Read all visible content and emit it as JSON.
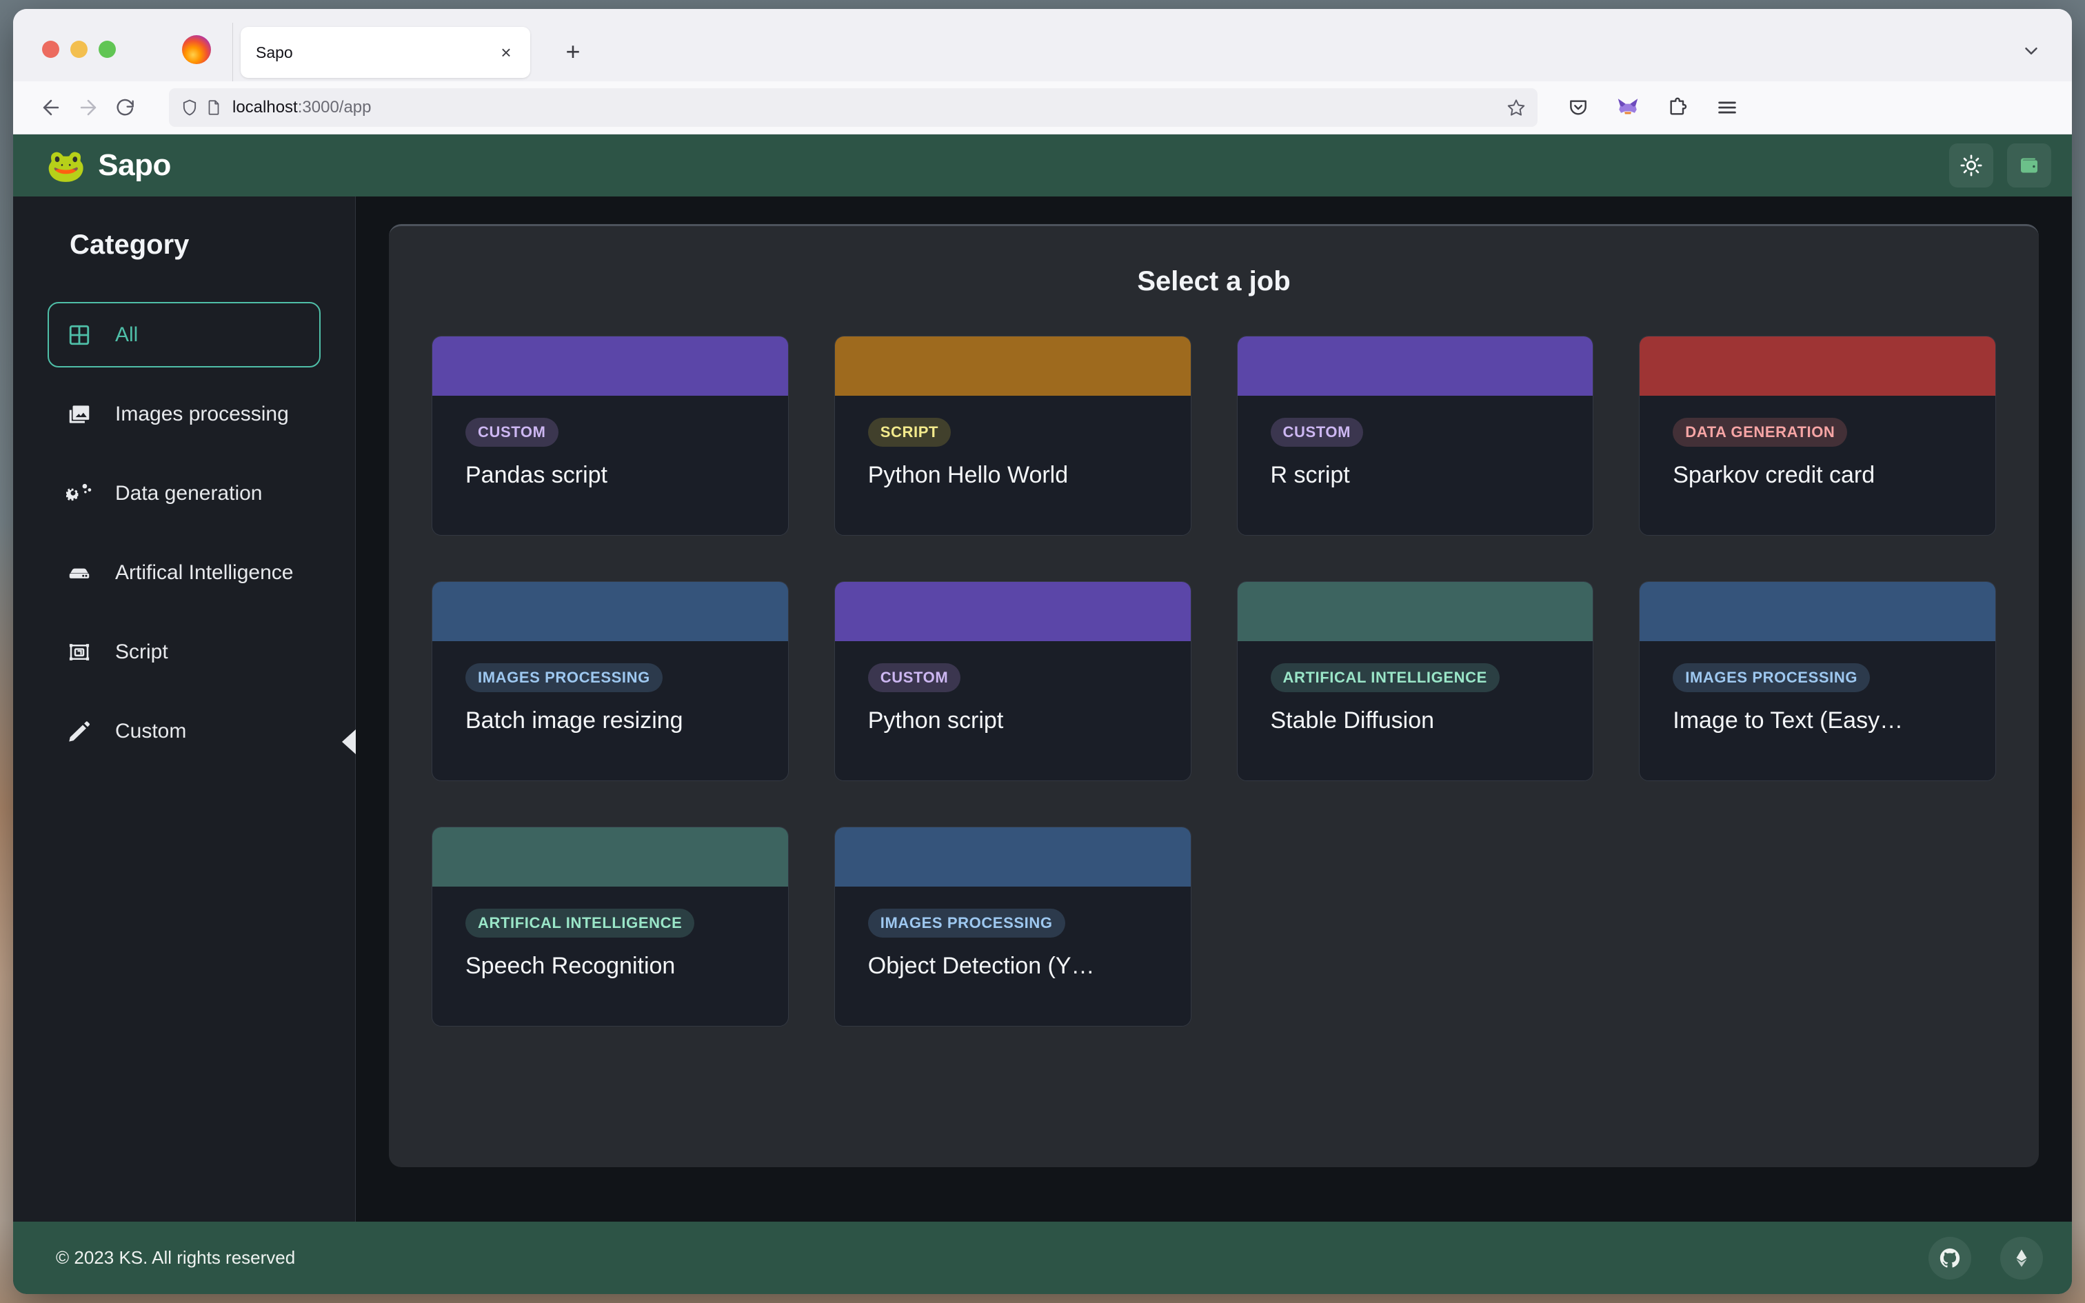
{
  "browser": {
    "tab_title": "Sapo",
    "url_host": "localhost",
    "url_path": ":3000/app",
    "close_glyph": "×",
    "newtab_glyph": "+",
    "tablist_chevron": "⌄",
    "icons": {
      "back": "back-arrow-icon",
      "forward": "forward-arrow-icon",
      "reload": "reload-icon",
      "shield": "shield-icon",
      "page": "page-icon",
      "bookmark": "star-icon",
      "pocket": "pocket-icon",
      "metamask": "metamask-fox-icon",
      "extensions": "extensions-puzzle-icon",
      "menu": "hamburger-menu-icon"
    }
  },
  "app": {
    "logo_emoji": "🐸",
    "name": "Sapo",
    "header_buttons": [
      {
        "name": "theme-toggle-button",
        "icon": "sun-icon"
      },
      {
        "name": "wallet-button",
        "icon": "wallet-icon"
      }
    ]
  },
  "sidebar": {
    "title": "Category",
    "items": [
      {
        "label": "All",
        "icon": "grid-icon",
        "active": true
      },
      {
        "label": "Images processing",
        "icon": "images-icon",
        "active": false
      },
      {
        "label": "Data generation",
        "icon": "gears-icon",
        "active": false
      },
      {
        "label": "Artifical Intelligence",
        "icon": "server-icon",
        "active": false
      },
      {
        "label": "Script",
        "icon": "script-frame-icon",
        "active": false
      },
      {
        "label": "Custom",
        "icon": "pencil-icon",
        "active": false
      }
    ],
    "collapse_icon": "collapse-left-arrow-icon"
  },
  "main": {
    "panel_title": "Select a job",
    "cards": [
      {
        "title": "Pandas script",
        "badge": "CUSTOM",
        "banner": "#5b46a8",
        "badge_bg": "#3b364f",
        "badge_fg": "#cdb7f2"
      },
      {
        "title": "Python Hello World",
        "badge": "SCRIPT",
        "banner": "#9e6a1e",
        "badge_bg": "#41402c",
        "badge_fg": "#f3ea8c"
      },
      {
        "title": "R script",
        "badge": "CUSTOM",
        "banner": "#5b46a8",
        "badge_bg": "#3b364f",
        "badge_fg": "#cdb7f2"
      },
      {
        "title": "Sparkov credit card",
        "badge": "DATA GENERATION",
        "banner": "#9e3434",
        "badge_bg": "#433037",
        "badge_fg": "#f6a5a5"
      },
      {
        "title": "Batch image resizing",
        "badge": "IMAGES PROCESSING",
        "banner": "#35547b",
        "badge_bg": "#2c3a4c",
        "badge_fg": "#9ec8f0"
      },
      {
        "title": "Python script",
        "badge": "CUSTOM",
        "banner": "#5b46a8",
        "badge_bg": "#3b364f",
        "badge_fg": "#cdb7f2"
      },
      {
        "title": "Stable Diffusion",
        "badge": "ARTIFICAL INTELLIGENCE",
        "banner": "#3d6460",
        "badge_bg": "#2b3f43",
        "badge_fg": "#9ae6c8"
      },
      {
        "title": "Image to Text (Easy…",
        "badge": "IMAGES PROCESSING",
        "banner": "#35547b",
        "badge_bg": "#2c3a4c",
        "badge_fg": "#9ec8f0"
      },
      {
        "title": "Speech Recognition",
        "badge": "ARTIFICAL INTELLIGENCE",
        "banner": "#3d6460",
        "badge_bg": "#2b3f43",
        "badge_fg": "#9ae6c8"
      },
      {
        "title": "Object Detection (Y…",
        "badge": "IMAGES PROCESSING",
        "banner": "#35547b",
        "badge_bg": "#2c3a4c",
        "badge_fg": "#9ec8f0"
      }
    ]
  },
  "footer": {
    "copyright": "© 2023 KS. All rights reserved",
    "icons": [
      {
        "name": "github-icon"
      },
      {
        "name": "ethereum-icon"
      }
    ]
  },
  "colors": {
    "brand_green": "#2d5446",
    "accent_teal": "#4fbfa8",
    "panel_bg": "#282b30",
    "card_bg": "#1a1e27",
    "app_bg": "#111418",
    "sidebar_bg": "#1b1e24"
  }
}
